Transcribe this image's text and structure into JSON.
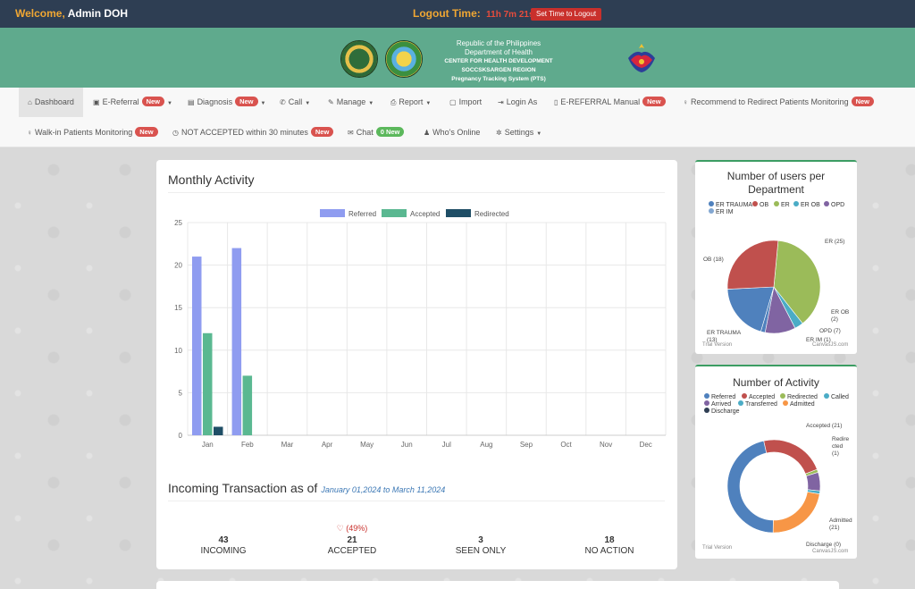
{
  "topbar": {
    "welcome_prefix": "Welcome,",
    "user_name": "Admin DOH",
    "logout_label": "Logout Time:",
    "logout_timer": "11h 7m 21s",
    "set_time_button": "Set Time to Logout"
  },
  "banner": {
    "line1": "Republic of the Philippines",
    "line2": "Department of Health",
    "line3": "CENTER FOR HEALTH DEVELOPMENT SOCCSKSARGEN REGION",
    "line4": "Pregnancy Tracking System (PTS)"
  },
  "nav": {
    "dashboard": "Dashboard",
    "ereferral": "E-Referral",
    "diagnosis": "Diagnosis",
    "call": "Call",
    "manage": "Manage",
    "report": "Report",
    "import": "Import",
    "login_as": "Login As",
    "ereferral_manual": "E-REFERRAL Manual",
    "recommend": "Recommend to Redirect Patients Monitoring",
    "walkin": "Walk-in Patients Monitoring",
    "not_accepted": "NOT ACCEPTED within 30 minutes",
    "chat": "Chat",
    "chat_badge": "0 New",
    "whos_online": "Who's Online",
    "settings": "Settings",
    "new_badge": "New"
  },
  "monthly": {
    "title": "Monthly Activity"
  },
  "incoming": {
    "title": "Incoming Transaction as of",
    "date_range": "January 01,2024 to March 11,2024",
    "accepted_pct": "(49%)",
    "stats": [
      {
        "value": "43",
        "label": "INCOMING"
      },
      {
        "value": "21",
        "label": "ACCEPTED"
      },
      {
        "value": "3",
        "label": "SEEN ONLY"
      },
      {
        "value": "18",
        "label": "NO ACTION"
      }
    ]
  },
  "users_chart": {
    "title_line1": "Number of users per",
    "title_line2": "Department",
    "trial": "Trial Version",
    "credit": "CanvasJS.com"
  },
  "activity_chart": {
    "title": "Number of Activity",
    "trial": "Trial Version",
    "credit": "CanvasJS.com"
  },
  "chart_data": [
    {
      "type": "bar",
      "categories": [
        "Jan",
        "Feb",
        "Mar",
        "Apr",
        "May",
        "Jun",
        "Jul",
        "Aug",
        "Sep",
        "Oct",
        "Nov",
        "Dec"
      ],
      "series": [
        {
          "name": "Referred",
          "color": "#8f9cf0",
          "values": [
            21,
            22,
            0,
            0,
            0,
            0,
            0,
            0,
            0,
            0,
            0,
            0
          ]
        },
        {
          "name": "Accepted",
          "color": "#5ab891",
          "values": [
            12,
            7,
            0,
            0,
            0,
            0,
            0,
            0,
            0,
            0,
            0,
            0
          ]
        },
        {
          "name": "Redirected",
          "color": "#1f4e66",
          "values": [
            1,
            0,
            0,
            0,
            0,
            0,
            0,
            0,
            0,
            0,
            0,
            0
          ]
        }
      ],
      "yticks": [
        0,
        5,
        10,
        15,
        20,
        25
      ],
      "ylim": [
        0,
        25
      ],
      "legend": "top-center",
      "grid": true
    },
    {
      "type": "pie",
      "legend": [
        "ER TRAUMA",
        "OB",
        "ER",
        "ER OB",
        "OPD",
        "ER IM"
      ],
      "slices": [
        {
          "label": "ER",
          "value": 25,
          "display": "ER (25)",
          "color": "#9bbb59"
        },
        {
          "label": "ER OB",
          "value": 2,
          "display": "ER OB (2)",
          "color": "#4bacc6"
        },
        {
          "label": "OPD",
          "value": 7,
          "display": "OPD (7)",
          "color": "#8064a2"
        },
        {
          "label": "ER IM",
          "value": 1,
          "display": "ER IM (1)",
          "color": "#4f81bd"
        },
        {
          "label": "ER TRAUMA",
          "value": 13,
          "display": "ER TRAUMA (13)",
          "color": "#4f81bd"
        },
        {
          "label": "OB",
          "value": 18,
          "display": "OB (18)",
          "color": "#c0504d"
        }
      ]
    },
    {
      "type": "pie",
      "legend": [
        "Referred",
        "Accepted",
        "Redirected",
        "Called",
        "Arrived",
        "Transferred",
        "Admitted",
        "Discharge"
      ],
      "slices": [
        {
          "label": "Accepted",
          "value": 21,
          "display": "Accepted (21)",
          "color": "#c0504d"
        },
        {
          "label": "Redirected",
          "value": 1,
          "display": "Redirected (1)",
          "color": "#9bbb59"
        },
        {
          "label": "Arrived",
          "value": 6,
          "display": "",
          "color": "#8064a2"
        },
        {
          "label": "Transferred",
          "value": 1,
          "display": "",
          "color": "#4bacc6"
        },
        {
          "label": "Admitted",
          "value": 21,
          "display": "Admitted (21)",
          "color": "#f79646"
        },
        {
          "label": "Discharge",
          "value": 0,
          "display": "Discharge (0)",
          "color": "#8064a2"
        },
        {
          "label": "Referred",
          "value": 43,
          "display": "",
          "color": "#4f81bd"
        }
      ]
    }
  ],
  "legend_colors": {
    "ER TRAUMA": "#4f81bd",
    "OB": "#c0504d",
    "ER": "#9bbb59",
    "ER OB": "#4bacc6",
    "OPD": "#8064a2",
    "ER IM": "#4f81bd",
    "Referred": "#4f81bd",
    "Accepted": "#c0504d",
    "Redirected": "#9bbb59",
    "Called": "#4bacc6",
    "Arrived": "#8064a2",
    "Transferred": "#4bacc6",
    "Admitted": "#f79646",
    "Discharge": "#2e3e53"
  }
}
